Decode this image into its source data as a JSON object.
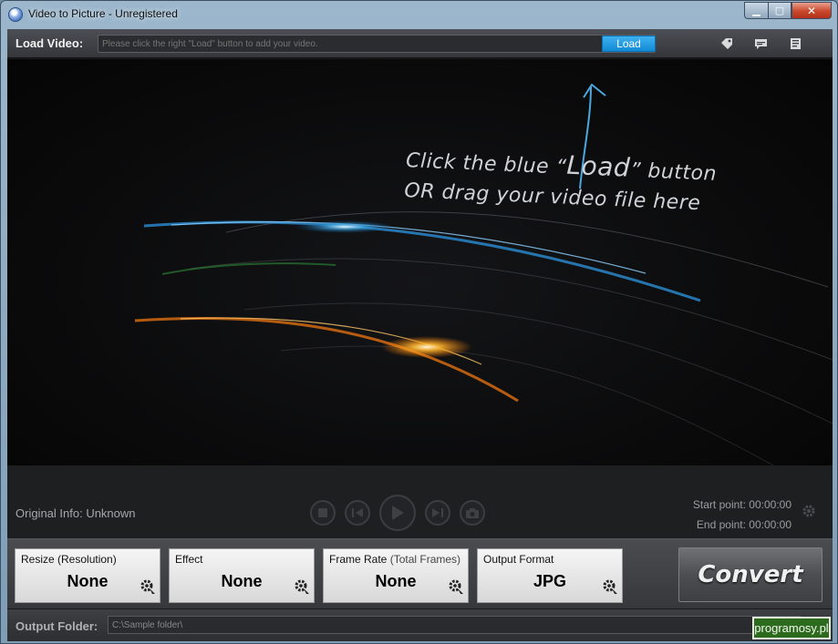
{
  "window": {
    "title": "Video to Picture - Unregistered",
    "min_glyph": "▁",
    "max_glyph": "▢",
    "close_glyph": "✕"
  },
  "load_bar": {
    "label": "Load Video:",
    "placeholder": "Please click the right \"Load\" button to add your video.",
    "load_button": "Load",
    "icons": [
      "tag-icon",
      "chat-icon",
      "document-icon"
    ]
  },
  "preview": {
    "hint_line1_a": "Click the blue “",
    "hint_line1_load": "Load",
    "hint_line1_b": "” button",
    "hint_line2": "OR drag your video file here"
  },
  "controls": {
    "original_info": "Original Info: Unknown",
    "start_point": "Start point: 00:00:00",
    "end_point": "End point: 00:00:00"
  },
  "settings": {
    "resize": {
      "label": "Resize (Resolution)",
      "value": "None"
    },
    "effect": {
      "label": "Effect",
      "value": "None"
    },
    "frame_rate": {
      "label": "Frame Rate",
      "sub": "(Total Frames)",
      "value": "None"
    },
    "output_format": {
      "label": "Output Format",
      "value": "JPG"
    },
    "convert_label": "Convert"
  },
  "output": {
    "label": "Output Folder:",
    "path": "C:\\Sample folder\\"
  },
  "watermark": "programosy.pl"
}
